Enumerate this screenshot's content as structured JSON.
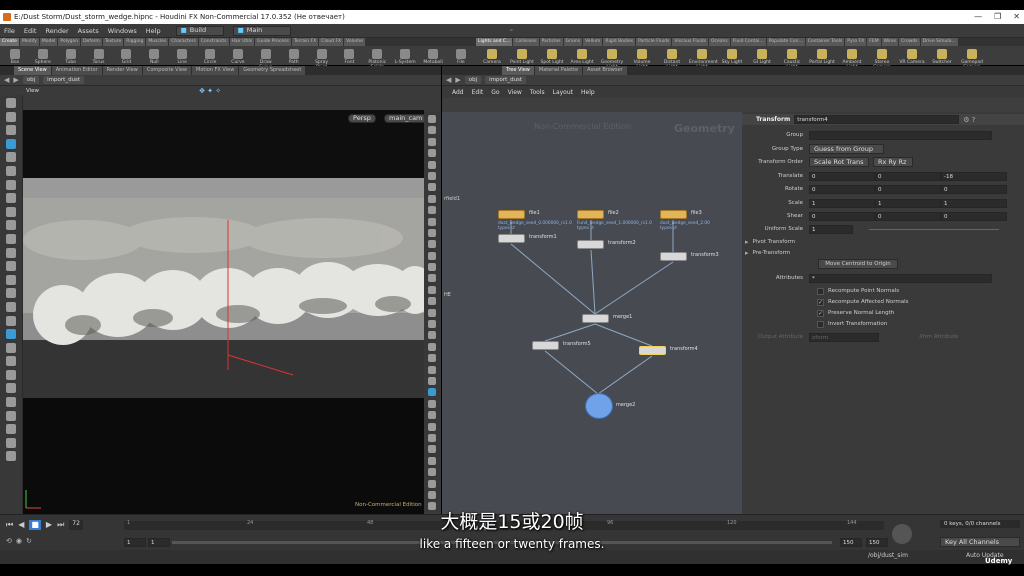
{
  "window": {
    "title": "E:/Dust Storm/Dust_storm_wedge.hipnc - Houdini FX Non-Commercial 17.0.352 (Не отвечает)",
    "controls": [
      "—",
      "❐",
      "✕"
    ]
  },
  "menubar": {
    "items": [
      "File",
      "Edit",
      "Render",
      "Assets",
      "Windows",
      "Help"
    ],
    "build": "Build",
    "desktop": "Main"
  },
  "left_shelf": {
    "tabs": [
      "Create",
      "Modify",
      "Model",
      "Polygon",
      "Deform",
      "Texture",
      "Rigging",
      "Muscles",
      "Characters",
      "Constraints",
      "Hair Utils",
      "Guide Process",
      "Terrain FX",
      "Cloud FX",
      "Volume"
    ],
    "tools": [
      "Box",
      "Sphere",
      "Tube",
      "Torus",
      "Grid",
      "Null",
      "Line",
      "Circle",
      "Curve",
      "Draw Curve",
      "Path",
      "Spray Paint",
      "Font",
      "Platonic Solids",
      "L-System",
      "Metaball",
      "File"
    ]
  },
  "right_shelf": {
    "tabs": [
      "Lights and C...",
      "Collisions",
      "Particles",
      "Grains",
      "Vellum",
      "Rigid Bodies",
      "Particle Fluids",
      "Viscous Fluids",
      "Oceans",
      "Fluid Contai...",
      "Populate Con...",
      "Container Tools",
      "Pyro FX",
      "FEM",
      "Wires",
      "Crowds",
      "Drive Simula..."
    ],
    "tools": [
      "Camera",
      "Point Light",
      "Spot Light",
      "Area Light",
      "Geometry Light",
      "Volume Light",
      "Distant Light",
      "Environment Light",
      "Sky Light",
      "GI Light",
      "Caustic Light",
      "Portal Light",
      "Ambient Light",
      "Stereo Camera",
      "VR Camera",
      "Switcher",
      "Gamepad Camera"
    ],
    "desktop": "Main"
  },
  "viewer": {
    "tabs": [
      "Scene View",
      "Animation Editor",
      "Render View",
      "Composite View",
      "Motion FX View",
      "Geometry Spreadsheet"
    ],
    "path": [
      "obj",
      "import_dust"
    ],
    "title": "View",
    "camera": "Persp",
    "cam2": "main_cam",
    "watermark": "Non-Commercial Edition"
  },
  "network": {
    "tabs": [
      "Tree View",
      "Material Palette",
      "Asset Browser"
    ],
    "path": [
      "obj",
      "import_dust"
    ],
    "menu": [
      "Add",
      "Edit",
      "Go",
      "View",
      "Tools",
      "Layout",
      "Help"
    ],
    "watermark": "Non-Commercial Edition",
    "context": "Geometry",
    "side_labels": [
      "rfield1",
      "HE"
    ],
    "nodes": [
      {
        "name": "file1",
        "sub": "dust_wedge_seed_0.000000_rs1.0",
        "sub2": "types ↺"
      },
      {
        "name": "file2",
        "sub": "Fund_wedge_seed_1.000000_rs1.0",
        "sub2": "types ↺"
      },
      {
        "name": "file3",
        "sub": "dust_wedge_seed_2.00",
        "sub2": "types ↺"
      },
      {
        "name": "transform1"
      },
      {
        "name": "transform2"
      },
      {
        "name": "transform3"
      },
      {
        "name": "merge1"
      },
      {
        "name": "transform5"
      },
      {
        "name": "transform4"
      },
      {
        "name": "merge2"
      }
    ]
  },
  "params": {
    "header_type": "Transform",
    "header_name": "transform4",
    "group_label": "Group",
    "group_type_label": "Group Type",
    "group_type": "Guess from Group",
    "order_label": "Transform Order",
    "order": "Scale Rot Trans",
    "rot_order": "Rx Ry Rz",
    "translate_label": "Translate",
    "translate": [
      "0",
      "0",
      "-18"
    ],
    "rotate_label": "Rotate",
    "rotate": [
      "0",
      "0",
      "0"
    ],
    "scale_label": "Scale",
    "scale": [
      "1",
      "1",
      "1"
    ],
    "shear_label": "Shear",
    "shear": [
      "0",
      "0",
      "0"
    ],
    "uscale_label": "Uniform Scale",
    "uscale": "1",
    "pivot_transform": "Pivot Transform",
    "pre_transform": "Pre-Transform",
    "move_centroid": "Move Centroid to Origin",
    "attributes_label": "Attributes",
    "attributes": "*",
    "checks": [
      {
        "label": "Recompute Point Normals",
        "checked": false
      },
      {
        "label": "Recompute Affected Normals",
        "checked": true
      },
      {
        "label": "Preserve Normal Length",
        "checked": true
      },
      {
        "label": "Invert Transformation",
        "checked": false
      }
    ],
    "output_attrib_label": "Output Attribute",
    "output_attrib": "xform",
    "output_attrib2": "Xfrm Attribute"
  },
  "timeline": {
    "frame": "72",
    "ticks": [
      "1",
      "24",
      "48",
      "72",
      "96",
      "120",
      "144"
    ],
    "start": "1",
    "start2": "1",
    "end": "150",
    "end2": "150",
    "channels": "0 keys, 0/0 channels",
    "key_all": "Key All Channels",
    "path": "/obj/dust_sim",
    "update": "Auto Update"
  },
  "subtitles": {
    "zh": "大概是15或20帧",
    "en": "like a fifteen or twenty frames."
  },
  "brand": "Udemy"
}
